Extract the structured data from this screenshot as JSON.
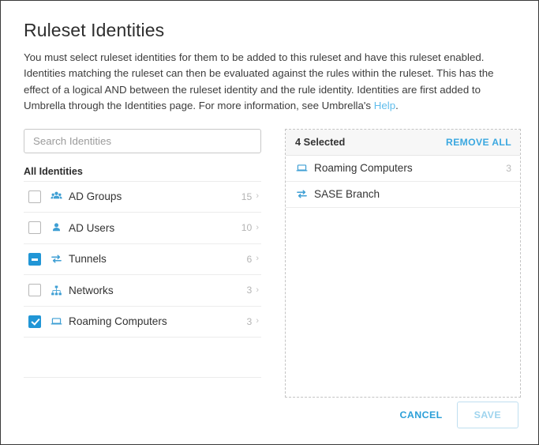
{
  "dialog": {
    "title": "Ruleset Identities",
    "description_part1": "You must select ruleset identities for them to be added to this ruleset and have this ruleset enabled. Identities matching the ruleset can then be evaluated against the rules within the ruleset. This has the effect of a logical AND between the ruleset identity and the rule identity. Identities are first added to Umbrella through the Identities page. For more information, see Umbrella's ",
    "help_link": "Help",
    "description_part2": "."
  },
  "search": {
    "placeholder": "Search Identities",
    "value": ""
  },
  "left_panel": {
    "section_title": "All Identities",
    "items": [
      {
        "label": "AD Groups",
        "count": "15",
        "chevron": "›",
        "checkbox_state": "unchecked",
        "icon": "ad-groups-icon"
      },
      {
        "label": "AD Users",
        "count": "10",
        "chevron": "›",
        "checkbox_state": "unchecked",
        "icon": "ad-users-icon"
      },
      {
        "label": "Tunnels",
        "count": "6",
        "chevron": "›",
        "checkbox_state": "indeterminate",
        "icon": "tunnels-icon"
      },
      {
        "label": "Networks",
        "count": "3",
        "chevron": "›",
        "checkbox_state": "unchecked",
        "icon": "networks-icon"
      },
      {
        "label": "Roaming Computers",
        "count": "3",
        "chevron": "›",
        "checkbox_state": "checked",
        "icon": "roaming-computers-icon"
      }
    ]
  },
  "right_panel": {
    "selected_label": "4 Selected",
    "remove_all_label": "REMOVE ALL",
    "items": [
      {
        "label": "Roaming Computers",
        "count": "3",
        "icon": "roaming-computers-icon"
      },
      {
        "label": "SASE Branch",
        "count": "",
        "icon": "tunnels-icon"
      }
    ]
  },
  "footer": {
    "cancel_label": "CANCEL",
    "save_label": "SAVE"
  },
  "colors": {
    "accent_blue": "#2b9fd8",
    "link_blue": "#60bdec",
    "checkbox_blue": "#2196d6",
    "icon_blue": "#3f9fd4",
    "muted_gray": "#b4b4b4",
    "header_bg": "#f7f7f7",
    "divider": "#ececec"
  }
}
